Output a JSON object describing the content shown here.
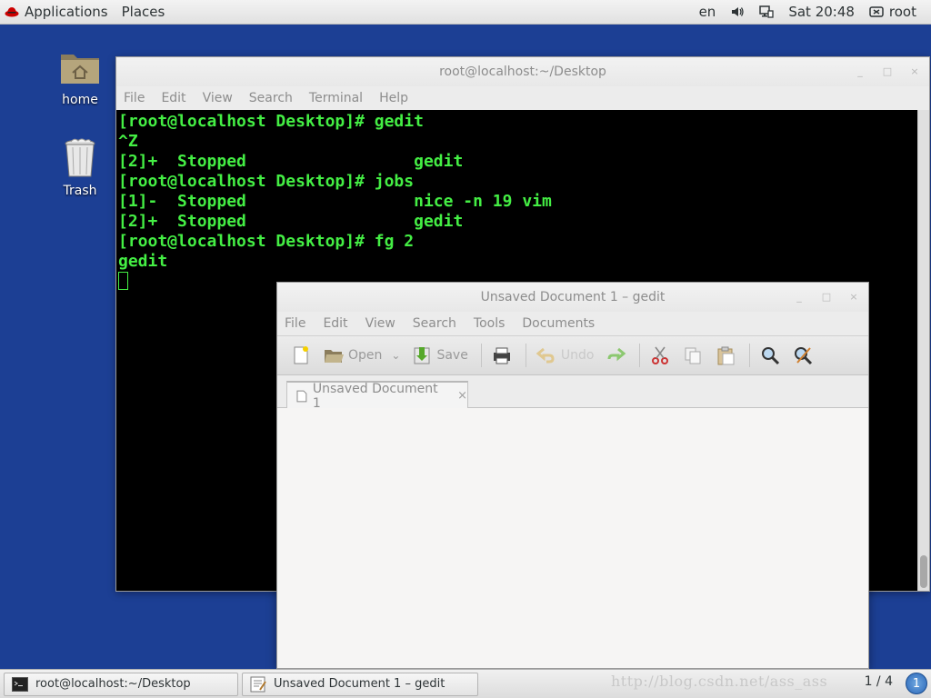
{
  "top_panel": {
    "applications": "Applications",
    "places": "Places",
    "lang": "en",
    "clock": "Sat 20:48",
    "user": "root"
  },
  "desktop": {
    "icons": [
      {
        "label": "home",
        "icon": "folder-home-icon"
      },
      {
        "label": "Trash",
        "icon": "trash-icon"
      }
    ]
  },
  "terminal": {
    "title": "root@localhost:~/Desktop",
    "menu": [
      "File",
      "Edit",
      "View",
      "Search",
      "Terminal",
      "Help"
    ],
    "lines": [
      "[root@localhost Desktop]# gedit",
      "^Z",
      "[2]+  Stopped                 gedit",
      "[root@localhost Desktop]# jobs",
      "[1]-  Stopped                 nice -n 19 vim",
      "[2]+  Stopped                 gedit",
      "[root@localhost Desktop]# fg 2",
      "gedit"
    ],
    "text_color": "#44ee44",
    "bg_color": "#000000"
  },
  "gedit": {
    "title": "Unsaved Document 1 – gedit",
    "menu": [
      "File",
      "Edit",
      "View",
      "Search",
      "Tools",
      "Documents"
    ],
    "toolbar": {
      "open_label": "Open",
      "save_label": "Save",
      "undo_label": "Undo"
    },
    "tab_label": "Unsaved Document 1",
    "tab_close": "×",
    "content": ""
  },
  "window_controls": {
    "minimize": "_",
    "maximize": "□",
    "close": "×"
  },
  "bottom_panel": {
    "tasks": [
      {
        "label": "root@localhost:~/Desktop",
        "icon": "terminal-icon"
      },
      {
        "label": "Unsaved Document 1 – gedit",
        "icon": "text-editor-icon"
      }
    ],
    "watermark": "http://blog.csdn.net/ass_ass",
    "pager": "1 / 4",
    "notification": "1"
  }
}
